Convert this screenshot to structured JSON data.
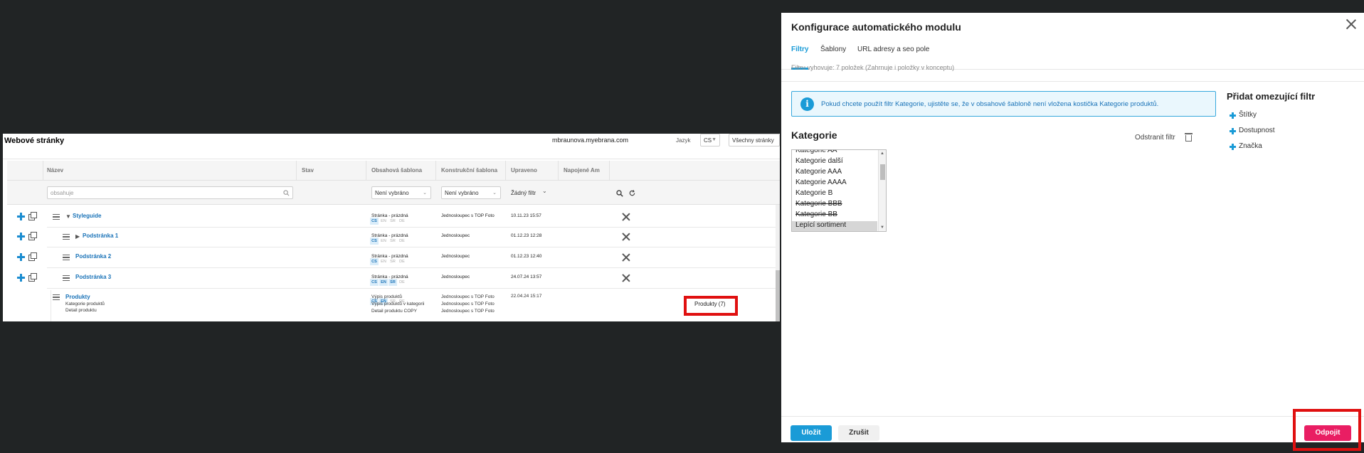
{
  "left": {
    "site_title": "Webové stránky",
    "domain": "mbraunova.myebrana.com",
    "language_label": "Jazyk",
    "language_value": "CS",
    "all_pages_value": "Všechny stránky",
    "columns": [
      "Název",
      "Stav",
      "Obsahová šablona",
      "Konstrukční šablona",
      "Upraveno",
      "Napojené Am"
    ],
    "filters": {
      "name_placeholder": "obsahuje",
      "content_template": "Není vybráno",
      "construct_template": "Není vybráno",
      "modified": "Žádný filtr"
    },
    "rows": [
      {
        "name": "Styleguide",
        "langs": [
          {
            "code": "CS",
            "on": true
          },
          {
            "code": "EN",
            "on": false
          },
          {
            "code": "SR",
            "on": false
          },
          {
            "code": "DE",
            "on": false
          }
        ],
        "content_template": "Stránka - prázdná",
        "construct_template": "Jednosloupec s TOP Foto",
        "modified": "10.11.23 15:57"
      },
      {
        "name": "Podstránka 1",
        "langs": [
          {
            "code": "CS",
            "on": true
          },
          {
            "code": "EN",
            "on": false
          },
          {
            "code": "SR",
            "on": false
          },
          {
            "code": "DE",
            "on": false
          }
        ],
        "content_template": "Stránka - prázdná",
        "construct_template": "Jednosloupec",
        "modified": "01.12.23 12:28"
      },
      {
        "name": "Podstránka 2",
        "langs": [
          {
            "code": "CS",
            "on": true
          },
          {
            "code": "EN",
            "on": false
          },
          {
            "code": "SR",
            "on": false
          },
          {
            "code": "DE",
            "on": false
          }
        ],
        "content_template": "Stránka - prázdná",
        "construct_template": "Jednosloupec",
        "modified": "01.12.23 12:40"
      },
      {
        "name": "Podstránka 3",
        "langs": [
          {
            "code": "CS",
            "on": true
          },
          {
            "code": "EN",
            "on": true
          },
          {
            "code": "SR",
            "on": true
          },
          {
            "code": "DE",
            "on": false
          }
        ],
        "content_template": "Stránka - prázdná",
        "construct_template": "Jednosloupec",
        "modified": "24.07.24 13:57"
      }
    ],
    "produkty": {
      "name": "Produkty",
      "sub1": "Kategorie produktů",
      "sub2": "Detail produktu",
      "langs": [
        {
          "code": "CS",
          "on": true
        },
        {
          "code": "EN",
          "on": true
        },
        {
          "code": "SR",
          "on": false
        },
        {
          "code": "DE",
          "on": false
        }
      ],
      "content_templates": [
        "Výpis produktů",
        "Výpis produktů v kategorii",
        "Detail produktu COPY"
      ],
      "construct_templates": [
        "Jednosloupec s TOP Foto",
        "Jednosloupec s TOP Foto",
        "Jednosloupec s TOP Foto"
      ],
      "modified": "22.04.24 15:17",
      "connected": "Produkty (7)"
    }
  },
  "panel": {
    "title": "Konfigurace automatického modulu",
    "tabs": [
      "Filtry",
      "Šablony",
      "URL adresy a seo pole"
    ],
    "filter_info": "Filtru vyhovuje: 7 položek (Zahrnuje i položky v konceptu)",
    "info_text": "Pokud chcete použít filtr Kategorie, ujistěte se, že v obsahové šabloně není vložena kostička Kategorie produktů.",
    "category_title": "Kategorie",
    "remove_filter": "Odstranit filtr",
    "category_options": [
      {
        "label": "Kategorie AA",
        "strike": false,
        "selected": false
      },
      {
        "label": "Kategorie další",
        "strike": false,
        "selected": false
      },
      {
        "label": "Kategorie AAA",
        "strike": false,
        "selected": false
      },
      {
        "label": "Kategorie AAAA",
        "strike": false,
        "selected": false
      },
      {
        "label": "Kategorie B",
        "strike": false,
        "selected": false
      },
      {
        "label": "Kategorie BBB",
        "strike": true,
        "selected": false
      },
      {
        "label": "Kategorie BB",
        "strike": true,
        "selected": false
      },
      {
        "label": "Lepící sortiment",
        "strike": false,
        "selected": true
      }
    ],
    "add_filter_title": "Přidat omezující filtr",
    "add_filters": [
      "Štítky",
      "Dostupnost",
      "Značka"
    ],
    "save": "Uložit",
    "cancel": "Zrušit",
    "detach": "Odpojit",
    "colors": {
      "accent": "#1a9bd7",
      "detach": "#e91e63",
      "highlight": "#e01010"
    }
  }
}
